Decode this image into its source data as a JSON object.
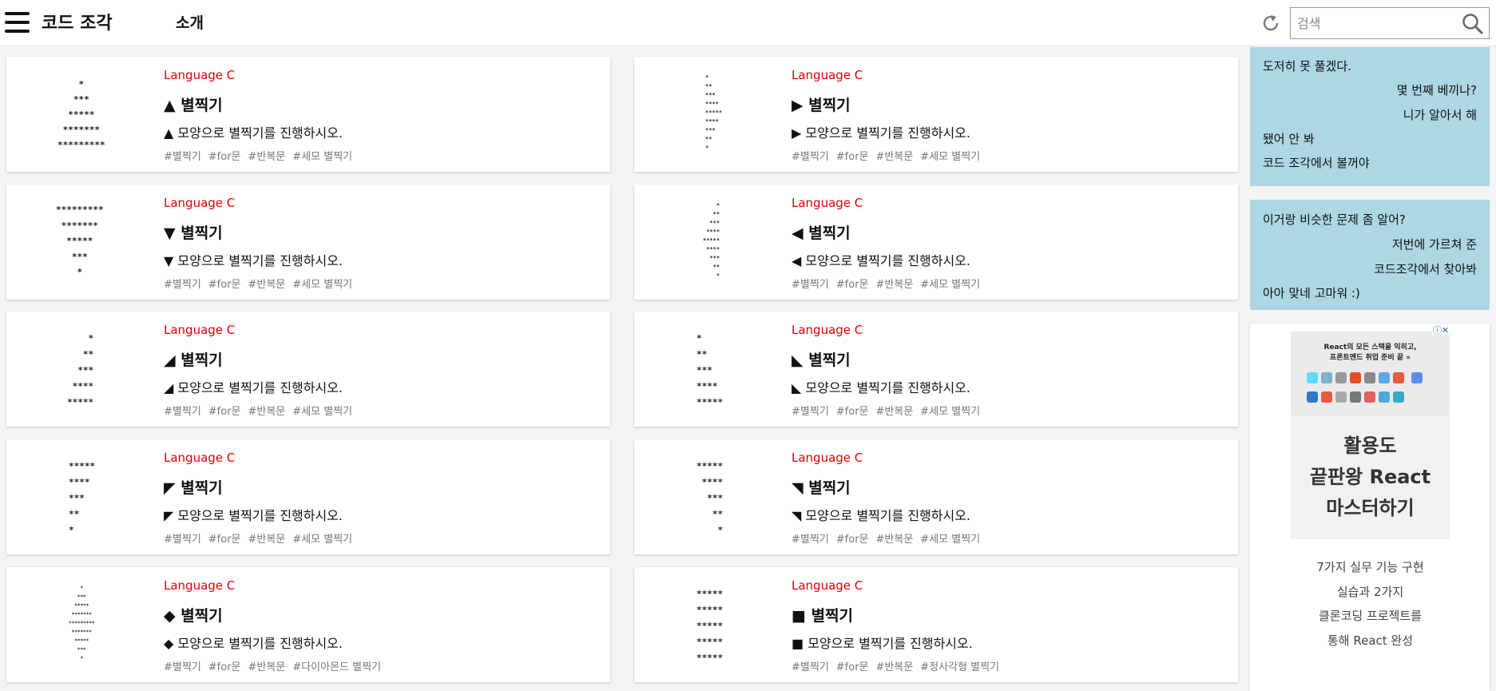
{
  "header": {
    "site_title": "코드 조각",
    "nav_about": "소개",
    "search_placeholder": "검색"
  },
  "cards": [
    {
      "thumb": "    *\n   ***\n  *****\n *******\n*********",
      "lang": "Language C",
      "title": "▲ 별찍기",
      "desc": "▲ 모양으로 별찍기를 진행하시오.",
      "tags": [
        "#별찍기",
        "#for문",
        "#반복문",
        "#세모 별찍기"
      ]
    },
    {
      "thumb": "*\n**\n***\n****\n*****\n****\n***\n**\n*",
      "lang": "Language C",
      "title": "▶ 별찍기",
      "desc": "▶ 모양으로 별찍기를 진행하시오.",
      "tags": [
        "#별찍기",
        "#for문",
        "#반복문",
        "#세모 별찍기"
      ]
    },
    {
      "thumb": "*********\n *******\n  *****\n   ***\n    *",
      "lang": "Language C",
      "title": "▼ 별찍기",
      "desc": "▼ 모양으로 별찍기를 진행하시오.",
      "tags": [
        "#별찍기",
        "#for문",
        "#반복문",
        "#세모 별찍기"
      ]
    },
    {
      "thumb": "    *\n   **\n  ***\n ****\n*****\n ****\n  ***\n   **\n    *",
      "lang": "Language C",
      "title": "◀ 별찍기",
      "desc": "◀ 모양으로 별찍기를 진행하시오.",
      "tags": [
        "#별찍기",
        "#for문",
        "#반복문",
        "#세모 별찍기"
      ]
    },
    {
      "thumb": "    *\n   **\n  ***\n ****\n*****",
      "lang": "Language C",
      "title": "◢ 별찍기",
      "desc": "◢ 모양으로 별찍기를 진행하시오.",
      "tags": [
        "#별찍기",
        "#for문",
        "#반복문",
        "#세모 별찍기"
      ]
    },
    {
      "thumb": "*\n**\n***\n****\n*****",
      "lang": "Language C",
      "title": "◣ 별찍기",
      "desc": "◣ 모양으로 별찍기를 진행하시오.",
      "tags": [
        "#별찍기",
        "#for문",
        "#반복문",
        "#세모 별찍기"
      ]
    },
    {
      "thumb": "*****\n****\n***\n**\n*",
      "lang": "Language C",
      "title": "◤ 별찍기",
      "desc": "◤ 모양으로 별찍기를 진행하시오.",
      "tags": [
        "#별찍기",
        "#for문",
        "#반복문",
        "#세모 별찍기"
      ]
    },
    {
      "thumb": "*****\n ****\n  ***\n   **\n    *",
      "lang": "Language C",
      "title": "◥ 별찍기",
      "desc": "◥ 모양으로 별찍기를 진행하시오.",
      "tags": [
        "#별찍기",
        "#for문",
        "#반복문",
        "#세모 별찍기"
      ]
    },
    {
      "thumb": "    *\n   ***\n  *****\n *******\n*********\n *******\n  *****\n   ***\n    *",
      "lang": "Language C",
      "title": "◆ 별찍기",
      "desc": "◆ 모양으로 별찍기를 진행하시오.",
      "tags": [
        "#별찍기",
        "#for문",
        "#반복문",
        "#다이아몬드 별찍기"
      ]
    },
    {
      "thumb": "*****\n*****\n*****\n*****\n*****",
      "lang": "Language C",
      "title": "■ 별찍기",
      "desc": "■ 모양으로 별찍기를 진행하시오.",
      "tags": [
        "#별찍기",
        "#for문",
        "#반복문",
        "#정사각형 별찍기"
      ]
    }
  ],
  "sidebar": {
    "chat1": [
      "도저히 못 풀겠다.",
      "몇 번째 베끼나?",
      "니가 알아서 해",
      "됐어 안 봐",
      "코드 조각에서 볼꺼야"
    ],
    "chat2": [
      "이거랑 비슷한 문제 좀 알어?",
      "저번에 가르쳐 준",
      "코드조각에서 찾아봐",
      "아아 맞네 고마워 :)"
    ],
    "ad": {
      "banner_line1": "React의 모든 스택을 익히고,",
      "banner_line2": "프론트엔드 취업 준비 끝 »",
      "headline": [
        "활용도",
        "끝판왕 React",
        "마스터하기"
      ],
      "body": [
        "7가지 실무 기능 구현",
        "실습과 2가지",
        "클론코딩 프로젝트를",
        "통해 React 완성"
      ]
    }
  }
}
